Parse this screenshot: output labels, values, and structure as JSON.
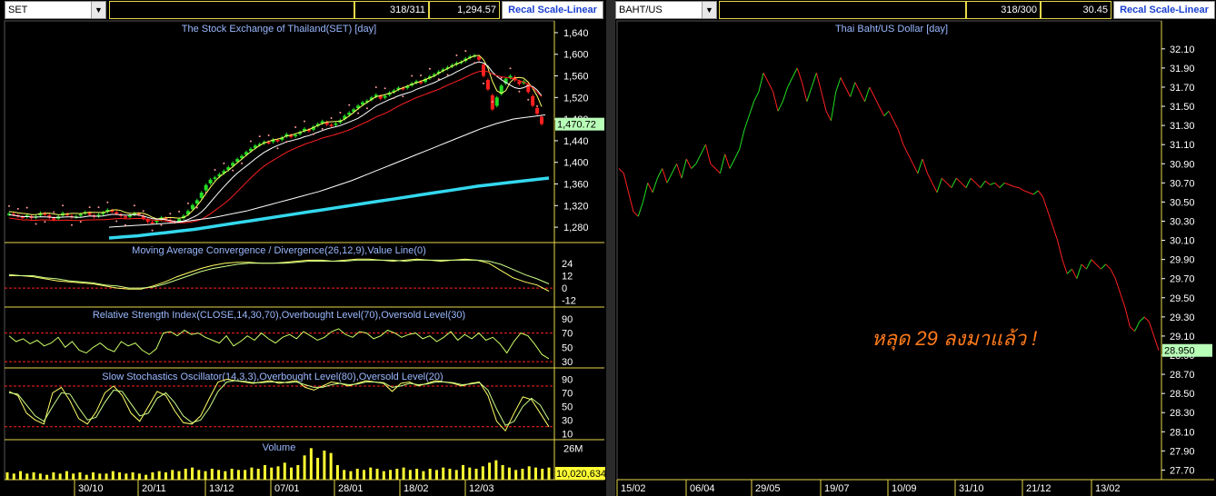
{
  "left": {
    "symbol": "SET",
    "count": "318/311",
    "value": "1,294.57",
    "recal_label": "Recal Scale-Linear",
    "title": "The Stock Exchange of Thailand(SET) [day]",
    "last_value": "1,470.72",
    "macd_title": "Moving Average Convergence / Divergence(26,12,9),Value Line(0)",
    "rsi_title": "Relative Strength Index(CLOSE,14,30,70),Overbought Level(70),Oversold Level(30)",
    "stoch_title": "Slow Stochastics Oscillator(14,3,3),Overbought Level(80),Oversold Level(20)",
    "volume_title": "Volume",
    "volume_last": "10,020,634",
    "volume_axis_label": "26M",
    "x_labels": [
      "30/10",
      "20/11",
      "13/12",
      "07/01",
      "28/01",
      "18/02",
      "12/03"
    ]
  },
  "right": {
    "symbol": "BAHT/US",
    "count": "318/300",
    "value": "30.45",
    "recal_label": "Recal Scale-Linear",
    "title": "Thai Baht/US Dollar [day]",
    "last_value": "28.950",
    "annotation": "หลุด 29 ลงมาแล้ว !",
    "x_labels": [
      "15/02",
      "06/04",
      "29/05",
      "19/07",
      "10/09",
      "31/10",
      "21/12",
      "13/02"
    ]
  },
  "colors": {
    "up": "#22dd22",
    "down": "#ff2020",
    "grid": "#e6d84a",
    "title": "#9ab8ff",
    "annotation": "#ff7a1a",
    "cyan": "#33d8ee",
    "last_box": "#b8ffb8",
    "volume": "#ffff33"
  },
  "chart_data": [
    {
      "type": "candlestick",
      "title": "The Stock Exchange of Thailand(SET) [day]",
      "ylim": [
        1260,
        1650
      ],
      "y_ticks": [
        1280,
        1320,
        1360,
        1400,
        1440,
        1480,
        1520,
        1560,
        1600,
        1640
      ],
      "x_labels": [
        "30/10",
        "20/11",
        "13/12",
        "07/01",
        "28/01",
        "18/02",
        "12/03"
      ],
      "close": [
        1305,
        1303,
        1300,
        1298,
        1302,
        1297,
        1300,
        1306,
        1304,
        1298,
        1294,
        1300,
        1306,
        1302,
        1298,
        1300,
        1304,
        1308,
        1303,
        1299,
        1303,
        1307,
        1312,
        1309,
        1305,
        1301,
        1298,
        1302,
        1306,
        1303,
        1296,
        1290,
        1288,
        1292,
        1298,
        1295,
        1291,
        1289,
        1295,
        1301,
        1310,
        1321,
        1330,
        1344,
        1358,
        1368,
        1372,
        1378,
        1384,
        1391,
        1399,
        1406,
        1412,
        1419,
        1425,
        1431,
        1434,
        1438,
        1436,
        1442,
        1440,
        1446,
        1452,
        1447,
        1451,
        1456,
        1462,
        1458,
        1466,
        1471,
        1476,
        1470,
        1468,
        1472,
        1478,
        1486,
        1492,
        1498,
        1505,
        1511,
        1514,
        1520,
        1525,
        1518,
        1523,
        1529,
        1533,
        1538,
        1536,
        1541,
        1546,
        1550,
        1547,
        1554,
        1559,
        1563,
        1568,
        1572,
        1576,
        1580,
        1584,
        1586,
        1592,
        1596,
        1598,
        1590,
        1560,
        1535,
        1498,
        1520,
        1542,
        1555,
        1560,
        1552,
        1545,
        1550,
        1530,
        1505,
        1490,
        1471
      ],
      "sma_slow": [
        1280,
        1281,
        1282,
        1283,
        1284,
        1285,
        1286,
        1287,
        1288,
        1290,
        1292,
        1294,
        1296,
        1298,
        1301,
        1304,
        1307,
        1310,
        1314,
        1318,
        1322,
        1326,
        1330,
        1334,
        1338,
        1342,
        1346,
        1351,
        1356,
        1361,
        1366,
        1372,
        1378,
        1384,
        1390,
        1396,
        1402,
        1408,
        1414,
        1420,
        1426,
        1432,
        1438,
        1444,
        1450,
        1456,
        1462,
        1467,
        1472,
        1476,
        1480,
        1482,
        1484,
        1486,
        1488
      ],
      "sma_long": [
        1260,
        1262,
        1264,
        1267,
        1270,
        1273,
        1276,
        1280,
        1284,
        1288,
        1292,
        1296,
        1300,
        1304,
        1308,
        1312,
        1316,
        1320,
        1324,
        1328,
        1332,
        1336,
        1340,
        1344,
        1348,
        1352,
        1356,
        1359,
        1362,
        1365,
        1368,
        1371
      ]
    },
    {
      "type": "line",
      "title": "Moving Average Convergence / Divergence(26,12,9),Value Line(0)",
      "ylim": [
        -14,
        30
      ],
      "y_ticks": [
        -12,
        0,
        12,
        24
      ],
      "series": [
        {
          "values": [
            12,
            12,
            11,
            9,
            7,
            6,
            5,
            4,
            2,
            0,
            -1,
            -1,
            2,
            6,
            11,
            15,
            19,
            22,
            24,
            25,
            25,
            24,
            24,
            25,
            26,
            27,
            27,
            26,
            27,
            28,
            28,
            27,
            26,
            27,
            28,
            27,
            26,
            27,
            28,
            27,
            24,
            17,
            10,
            6,
            3,
            -3
          ]
        },
        {
          "values": [
            13,
            12,
            12,
            10,
            9,
            7,
            6,
            5,
            3,
            2,
            0,
            0,
            1,
            4,
            8,
            12,
            16,
            19,
            21,
            23,
            24,
            24,
            24,
            24,
            25,
            26,
            26,
            26,
            26,
            27,
            27,
            27,
            27,
            26,
            27,
            27,
            27,
            27,
            27,
            27,
            26,
            23,
            18,
            13,
            9,
            4
          ]
        }
      ]
    },
    {
      "type": "line",
      "title": "Relative Strength Index(CLOSE,14,30,70),Overbought Level(70),Oversold Level(30)",
      "ylim": [
        25,
        100
      ],
      "y_ticks": [
        30,
        50,
        70,
        90
      ],
      "levels": [
        70,
        30
      ],
      "series": [
        {
          "values": [
            66,
            58,
            62,
            55,
            60,
            52,
            56,
            64,
            50,
            58,
            46,
            42,
            50,
            56,
            48,
            44,
            58,
            52,
            56,
            46,
            40,
            48,
            70,
            72,
            66,
            74,
            68,
            70,
            64,
            60,
            56,
            66,
            52,
            58,
            66,
            60,
            70,
            62,
            56,
            64,
            68,
            62,
            72,
            66,
            60,
            64,
            72,
            76,
            68,
            64,
            72,
            70,
            62,
            66,
            74,
            70,
            64,
            68,
            70,
            62,
            66,
            58,
            64,
            72,
            60,
            68,
            62,
            70,
            60,
            64,
            55,
            42,
            58,
            70,
            66,
            54,
            40,
            34
          ]
        }
      ]
    },
    {
      "type": "line",
      "title": "Slow Stochastics Oscillator(14,3,3),Overbought Level(80),Oversold Level(20)",
      "ylim": [
        5,
        100
      ],
      "y_ticks": [
        10,
        30,
        50,
        70,
        90
      ],
      "levels": [
        80,
        20
      ],
      "series": [
        {
          "values": [
            72,
            66,
            40,
            30,
            24,
            70,
            78,
            58,
            32,
            24,
            42,
            70,
            80,
            66,
            40,
            28,
            50,
            72,
            66,
            44,
            26,
            24,
            36,
            62,
            86,
            90,
            88,
            86,
            84,
            86,
            88,
            84,
            86,
            88,
            78,
            74,
            80,
            86,
            84,
            80,
            84,
            88,
            86,
            84,
            72,
            84,
            86,
            80,
            84,
            88,
            86,
            84,
            80,
            84,
            86,
            66,
            28,
            14,
            40,
            64,
            60,
            40,
            20
          ]
        },
        {
          "values": [
            70,
            68,
            52,
            36,
            28,
            50,
            70,
            68,
            48,
            30,
            34,
            56,
            74,
            72,
            54,
            36,
            40,
            62,
            70,
            56,
            36,
            26,
            30,
            48,
            72,
            86,
            88,
            87,
            85,
            85,
            86,
            86,
            85,
            86,
            82,
            78,
            78,
            82,
            84,
            82,
            83,
            86,
            86,
            85,
            78,
            80,
            84,
            82,
            83,
            86,
            86,
            85,
            82,
            83,
            85,
            74,
            46,
            22,
            28,
            50,
            62,
            52,
            30
          ]
        }
      ]
    },
    {
      "type": "bar",
      "title": "Volume",
      "ylim": [
        0,
        30
      ],
      "y_ticks": [
        26
      ],
      "unit": "M",
      "values": [
        6,
        5,
        7,
        5,
        6,
        5,
        4,
        6,
        5,
        7,
        5,
        6,
        4,
        6,
        5,
        5,
        7,
        6,
        5,
        6,
        5,
        4,
        6,
        7,
        6,
        8,
        7,
        9,
        10,
        8,
        7,
        9,
        8,
        7,
        9,
        8,
        8,
        10,
        9,
        12,
        10,
        11,
        14,
        10,
        12,
        20,
        26,
        18,
        24,
        22,
        12,
        8,
        7,
        9,
        8,
        10,
        9,
        7,
        8,
        9,
        10,
        8,
        9,
        7,
        9,
        8,
        10,
        9,
        8,
        12,
        10,
        9,
        11,
        14,
        16,
        12,
        10,
        8,
        9,
        11,
        10,
        9,
        10
      ]
    },
    {
      "type": "line",
      "title": "Thai Baht/US Dollar [day]",
      "ylim": [
        27.6,
        32.25
      ],
      "y_ticks": [
        27.7,
        27.9,
        28.1,
        28.3,
        28.5,
        28.7,
        28.9,
        29.1,
        29.3,
        29.5,
        29.7,
        29.9,
        30.1,
        30.3,
        30.5,
        30.7,
        30.9,
        31.1,
        31.3,
        31.5,
        31.7,
        31.9,
        32.1
      ],
      "x_labels": [
        "15/02",
        "06/04",
        "29/05",
        "19/07",
        "10/09",
        "31/10",
        "21/12",
        "13/02"
      ],
      "values": [
        30.85,
        30.8,
        30.6,
        30.4,
        30.35,
        30.5,
        30.7,
        30.6,
        30.75,
        30.85,
        30.7,
        30.8,
        30.9,
        30.75,
        30.95,
        30.85,
        30.9,
        31.0,
        31.1,
        30.9,
        30.85,
        30.8,
        31.0,
        30.85,
        30.95,
        31.05,
        31.25,
        31.4,
        31.55,
        31.65,
        31.85,
        31.75,
        31.65,
        31.45,
        31.55,
        31.7,
        31.8,
        31.9,
        31.75,
        31.55,
        31.7,
        31.85,
        31.65,
        31.45,
        31.35,
        31.65,
        31.8,
        31.7,
        31.6,
        31.75,
        31.65,
        31.55,
        31.7,
        31.6,
        31.5,
        31.4,
        31.45,
        31.35,
        31.25,
        31.1,
        31.0,
        30.9,
        30.8,
        30.95,
        30.8,
        30.7,
        30.6,
        30.75,
        30.7,
        30.65,
        30.75,
        30.7,
        30.65,
        30.75,
        30.7,
        30.65,
        30.72,
        30.68,
        30.7,
        30.65,
        30.7,
        30.68,
        30.66,
        30.65,
        30.62,
        30.6,
        30.58,
        30.62,
        30.55,
        30.4,
        30.25,
        30.1,
        29.9,
        29.75,
        29.8,
        29.7,
        29.85,
        29.8,
        29.9,
        29.85,
        29.8,
        29.85,
        29.8,
        29.7,
        29.55,
        29.4,
        29.2,
        29.15,
        29.25,
        29.3,
        29.25,
        29.1,
        28.95
      ]
    }
  ]
}
